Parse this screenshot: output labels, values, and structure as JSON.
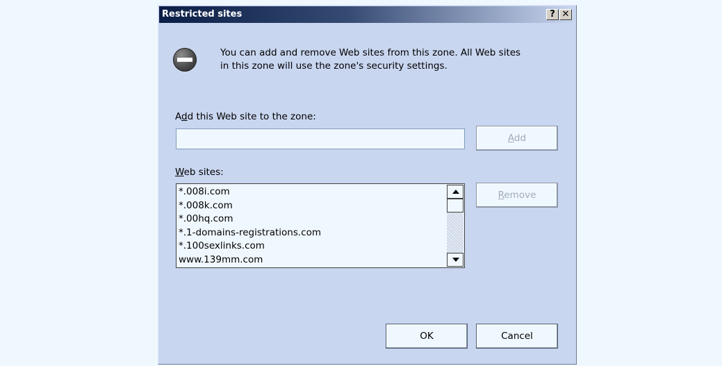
{
  "dialog": {
    "title": "Restricted sites",
    "help_glyph": "?",
    "close_glyph": "✕",
    "icon": "restricted-zone-icon",
    "description_line1": "You can add and remove Web sites from this zone. All Web sites",
    "description_line2": "in this zone will use the zone's security settings."
  },
  "add_site": {
    "label_pre": "A",
    "label_mnemonic": "d",
    "label_post": "d this Web site to the zone:",
    "value": "",
    "placeholder": ""
  },
  "buttons": {
    "add_pre": "",
    "add_mnemonic": "A",
    "add_post": "dd",
    "add_enabled": false,
    "remove_pre": "",
    "remove_mnemonic": "R",
    "remove_post": "emove",
    "remove_enabled": false,
    "ok": "OK",
    "cancel": "Cancel"
  },
  "web_sites": {
    "label_mnemonic": "W",
    "label_post": "eb sites:",
    "items": [
      "*.008i.com",
      "*.008k.com",
      "*.00hq.com",
      "*.1-domains-registrations.com",
      "*.100sexlinks.com",
      "www.139mm.com"
    ]
  },
  "colors": {
    "dialog_bg": "#c9d6f0",
    "titlebar_dark": "#0a1e46",
    "field_bg": "#f0f8ff",
    "disabled_text": "#a0aab8"
  }
}
